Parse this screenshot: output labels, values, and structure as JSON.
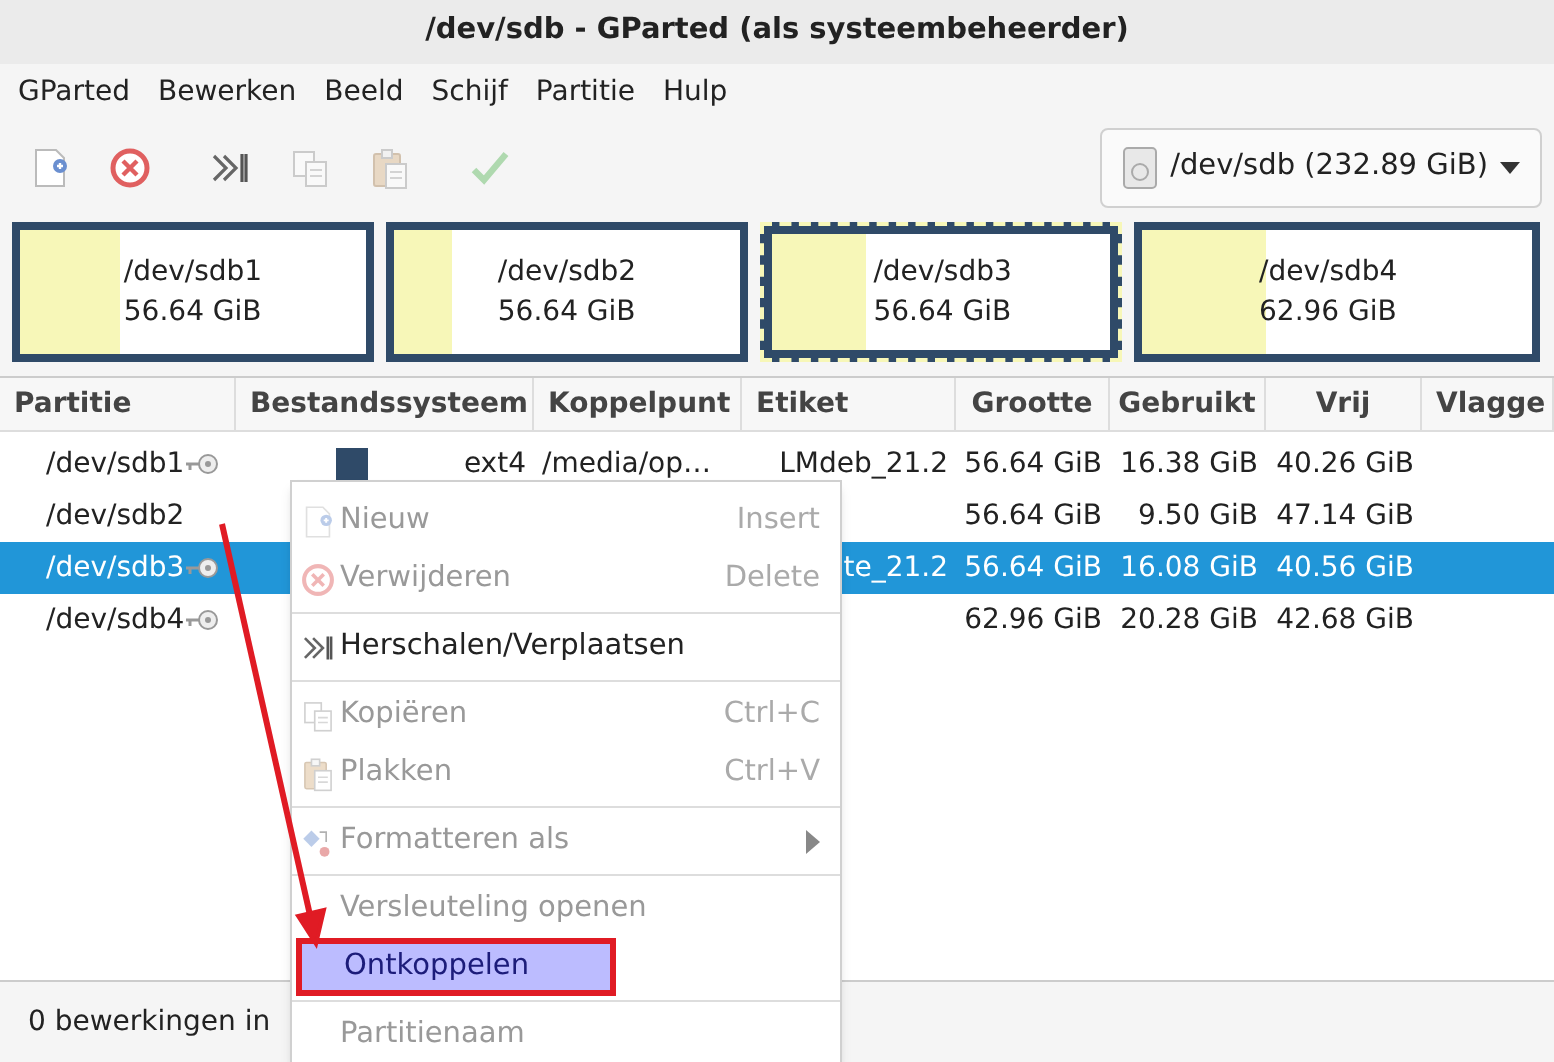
{
  "window": {
    "title": "/dev/sdb - GParted (als systeembeheerder)"
  },
  "menubar": [
    "GParted",
    "Bewerken",
    "Beeld",
    "Schijf",
    "Partitie",
    "Hulp"
  ],
  "toolbar": [
    {
      "disabled": false
    },
    {
      "disabled": false
    },
    {
      "disabled": false
    },
    {
      "disabled": true
    },
    {
      "disabled": true
    },
    {
      "disabled": true
    }
  ],
  "device_selector": {
    "label": "/dev/sdb (232.89 GiB)"
  },
  "disk_map": [
    {
      "name": "/dev/sdb1",
      "size": "56.64 GiB",
      "level": 0.29,
      "selected": false
    },
    {
      "name": "/dev/sdb2",
      "size": "56.64 GiB",
      "level": 0.17,
      "selected": false
    },
    {
      "name": "/dev/sdb3",
      "size": "56.64 GiB",
      "level": 0.28,
      "selected": true
    },
    {
      "name": "/dev/sdb4",
      "size": "62.96 GiB",
      "level": 0.32,
      "selected": false
    }
  ],
  "table": {
    "columns": [
      "Partitie",
      "Bestandssysteem",
      "Koppelpunt",
      "Etiket",
      "Grootte",
      "Gebruikt",
      "Vrij",
      "Vlagge"
    ],
    "rows": [
      {
        "partition": "/dev/sdb1",
        "key": true,
        "filesystem": "ext4",
        "mountpoint": "/media/op…",
        "label": "LMdeb_21.2",
        "size": "56.64 GiB",
        "used": "16.38 GiB",
        "free": "40.26 GiB",
        "selected": false
      },
      {
        "partition": "/dev/sdb2",
        "key": false,
        "size": "56.64 GiB",
        "used": "9.50 GiB",
        "free": "47.14 GiB",
        "selected": false
      },
      {
        "partition": "/dev/sdb3",
        "key": true,
        "label": "te_21.2",
        "size": "56.64 GiB",
        "used": "16.08 GiB",
        "free": "40.56 GiB",
        "selected": true
      },
      {
        "partition": "/dev/sdb4",
        "key": true,
        "size": "62.96 GiB",
        "used": "20.28 GiB",
        "free": "42.68 GiB",
        "selected": false
      }
    ]
  },
  "context_menu": [
    {
      "kind": "item",
      "label": "Nieuw",
      "shortcut": "Insert",
      "disabled": true,
      "selected": false
    },
    {
      "kind": "item",
      "label": "Verwijderen",
      "shortcut": "Delete",
      "disabled": true,
      "selected": false
    },
    {
      "kind": "separator"
    },
    {
      "kind": "item",
      "label": "Herschalen/Verplaatsen",
      "disabled": false,
      "selected": false
    },
    {
      "kind": "separator"
    },
    {
      "kind": "item",
      "label": "Kopiëren",
      "shortcut": "Ctrl+C",
      "disabled": true,
      "selected": false
    },
    {
      "kind": "item",
      "label": "Plakken",
      "shortcut": "Ctrl+V",
      "disabled": true,
      "selected": false
    },
    {
      "kind": "separator"
    },
    {
      "kind": "submenu",
      "label": "Formatteren als",
      "disabled": true,
      "selected": false
    },
    {
      "kind": "separator"
    },
    {
      "kind": "item",
      "label": "Versleuteling openen",
      "disabled": true,
      "selected": false
    },
    {
      "kind": "item",
      "label": "Ontkoppelen",
      "disabled": false,
      "selected": true
    },
    {
      "kind": "separator"
    },
    {
      "kind": "item",
      "label": "Partitienaam",
      "disabled": true,
      "selected": false
    }
  ],
  "status_bar": {
    "text": "0 bewerkingen in"
  }
}
